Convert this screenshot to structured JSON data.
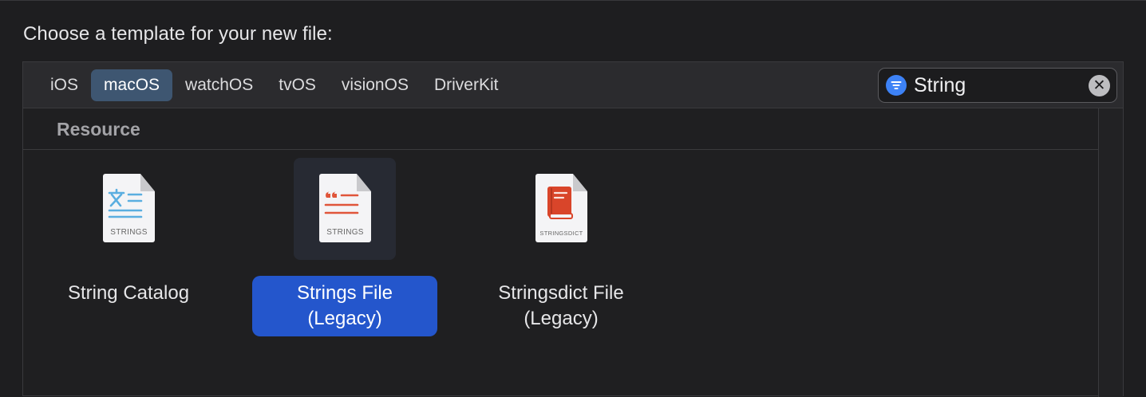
{
  "prompt": "Choose a template for your new file:",
  "tabs": [
    {
      "label": "iOS",
      "selected": false
    },
    {
      "label": "macOS",
      "selected": true
    },
    {
      "label": "watchOS",
      "selected": false
    },
    {
      "label": "tvOS",
      "selected": false
    },
    {
      "label": "visionOS",
      "selected": false
    },
    {
      "label": "DriverKit",
      "selected": false
    }
  ],
  "search": {
    "value": "String",
    "filter_icon": "filter-icon",
    "clear_icon": "clear-icon"
  },
  "section": {
    "title": "Resource"
  },
  "templates": [
    {
      "label": "String Catalog",
      "icon_caption": "STRINGS",
      "icon": "string-catalog-icon",
      "selected": false
    },
    {
      "label": "Strings File\n(Legacy)",
      "icon_caption": "STRINGS",
      "icon": "strings-file-icon",
      "selected": true
    },
    {
      "label": "Stringsdict File\n(Legacy)",
      "icon_caption": "STRINGSDICT",
      "icon": "stringsdict-file-icon",
      "selected": false
    }
  ],
  "colors": {
    "accent": "#2456cc",
    "tab_selected": "#3e5671",
    "catalog_icon": "#5aaee0",
    "strings_icon": "#e0553a"
  }
}
